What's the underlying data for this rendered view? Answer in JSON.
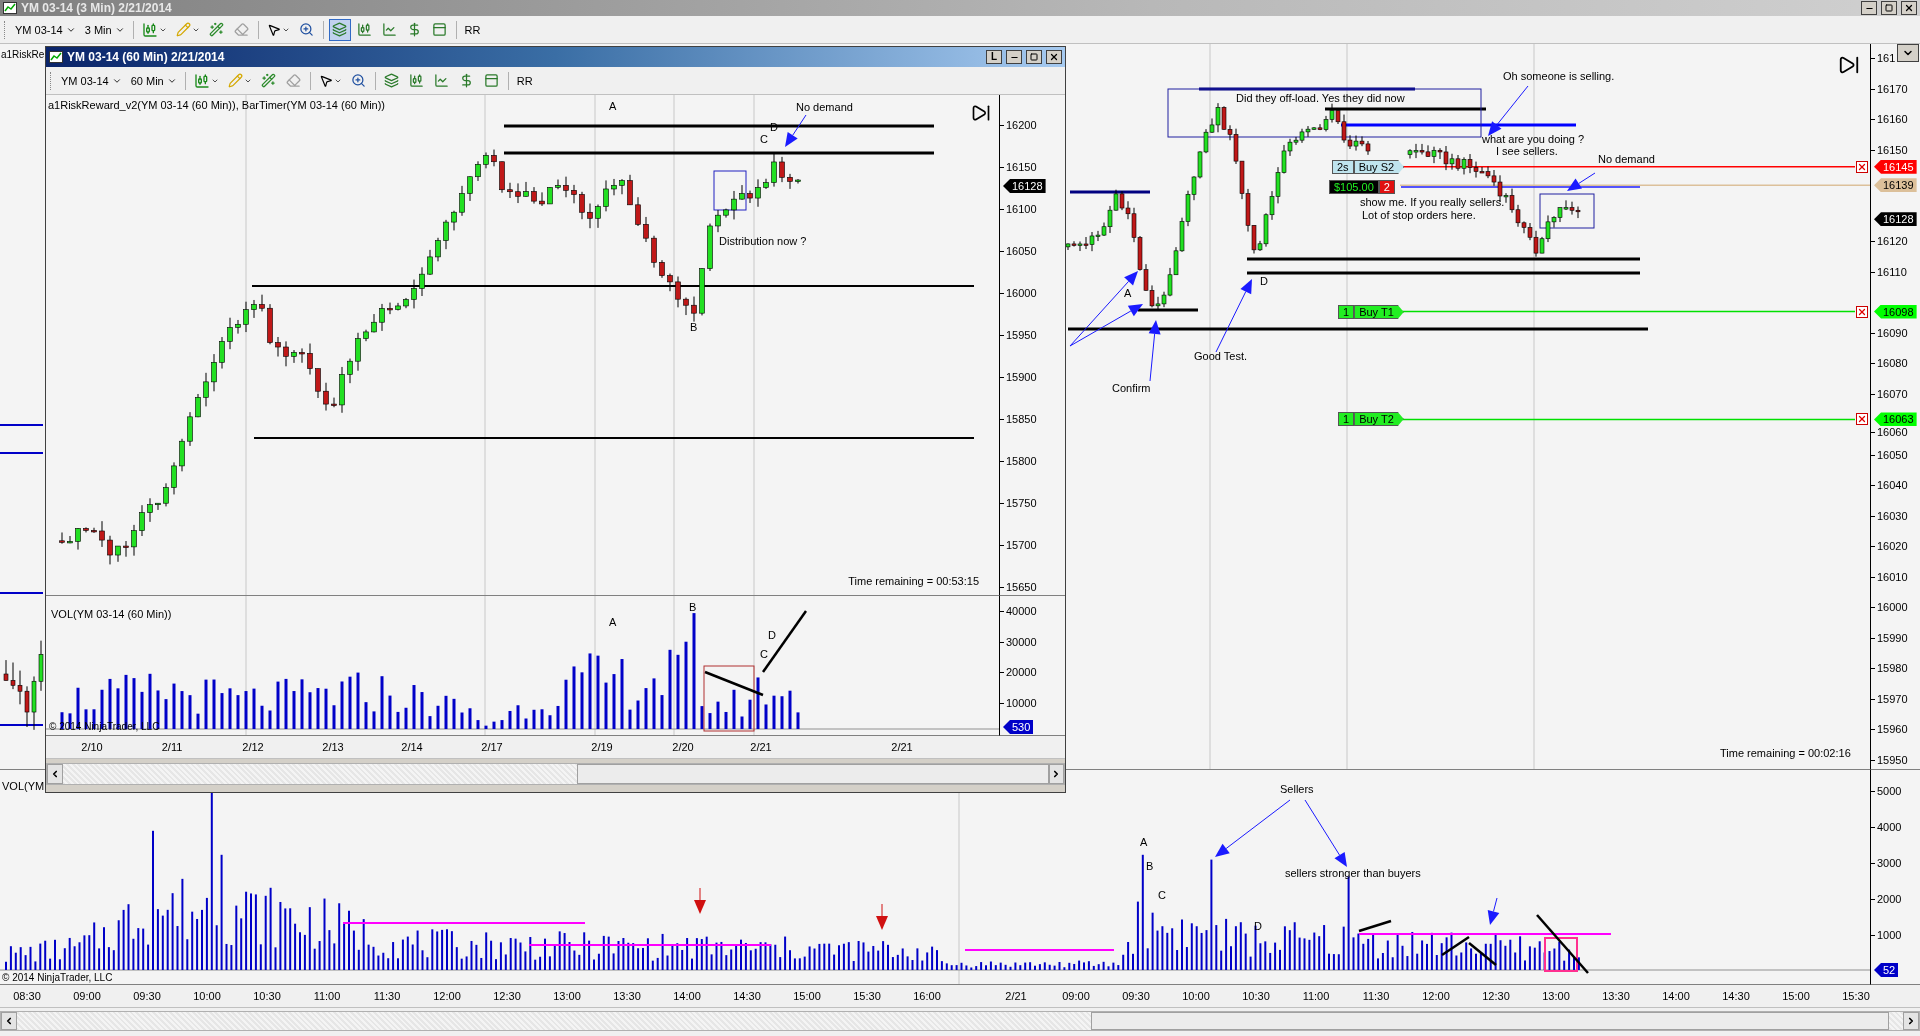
{
  "window": {
    "title": "YM 03-14 (3 Min)  2/21/2014"
  },
  "toolbar": {
    "instrument": "YM 03-14",
    "interval": "3 Min",
    "rr": "RR",
    "chart_tools": [
      {
        "kind": "strategy",
        "selected": true
      },
      {
        "kind": "bars",
        "selected": false
      },
      {
        "kind": "line",
        "selected": false
      },
      {
        "kind": "dollar",
        "selected": false
      },
      {
        "kind": "properties",
        "selected": false
      }
    ]
  },
  "chart": {
    "indicator_label": "a1RiskRe",
    "price_axis": [
      "161",
      "16170",
      "16160",
      "16150",
      "16120",
      "16110",
      "16090",
      "16080",
      "16070",
      "16060",
      "16050",
      "16040",
      "16030",
      "16020",
      "16010",
      "16000",
      "15990",
      "15980",
      "15970",
      "15960",
      "15950"
    ],
    "price_markers": [
      {
        "text": "16145",
        "color": "#ff0000"
      },
      {
        "text": "16139",
        "color": "#dcc09a"
      },
      {
        "text": "16128",
        "color": "#000000"
      },
      {
        "text": "16098",
        "color": "#00ff00"
      },
      {
        "text": "16063",
        "color": "#00ff00"
      }
    ],
    "orders": [
      {
        "kind": "stop",
        "qty": "2s",
        "label": "Buy S2"
      },
      {
        "kind": "target",
        "qty": "1",
        "label": "Buy T1"
      },
      {
        "kind": "target",
        "qty": "1",
        "label": "Buy T2"
      }
    ],
    "position": {
      "pnl": "$105.00",
      "qty": "2"
    },
    "annotations": [
      "Did they off-load. Yes they did now",
      "Oh someone is selling.",
      "what are you doing ?",
      "I see sellers.",
      "No demand",
      "show me. If you really sellers.",
      "Lot of stop orders here.",
      "Confirm",
      "Good Test.",
      "A",
      "D"
    ],
    "timer": "Time remaining = 00:02:16"
  },
  "volume": {
    "label": "VOL(YM",
    "axis": [
      "5000",
      "4000",
      "3000",
      "2000",
      "1000"
    ],
    "marker": "52",
    "annotations": [
      "Sellers",
      "sellers stronger than buyers",
      "A",
      "B",
      "C",
      "D"
    ],
    "copyright": "© 2014 NinjaTrader, LLC"
  },
  "time_axis": [
    "08:30",
    "09:00",
    "09:30",
    "10:00",
    "10:30",
    "11:00",
    "11:30",
    "12:00",
    "12:30",
    "13:00",
    "13:30",
    "14:00",
    "14:30",
    "15:00",
    "15:30",
    "16:00",
    "2/21",
    "09:00",
    "09:30",
    "10:00",
    "10:30",
    "11:00",
    "11:30",
    "12:00",
    "12:30",
    "13:00",
    "13:30",
    "14:00",
    "14:30",
    "15:00",
    "15:30"
  ],
  "inner_window": {
    "title": "YM 03-14 (60 Min)  2/21/2014",
    "layout_button": "L",
    "toolbar": {
      "instrument": "YM 03-14",
      "interval": "60 Min",
      "rr": "RR",
      "chart_tools": [
        {
          "kind": "strategy",
          "selected": false
        },
        {
          "kind": "bars",
          "selected": false
        },
        {
          "kind": "line",
          "selected": false
        },
        {
          "kind": "dollar",
          "selected": false
        },
        {
          "kind": "properties",
          "selected": false
        }
      ]
    },
    "indicator_label": "a1RiskReward_v2(YM 03-14 (60 Min)), BarTimer(YM 03-14 (60 Min))",
    "price_axis": [
      "16200",
      "16150",
      "16100",
      "16050",
      "16000",
      "15950",
      "15900",
      "15850",
      "15800",
      "15750",
      "15700",
      "15650"
    ],
    "price_marker": "16128",
    "annotations": [
      "A",
      "No demand",
      "C",
      "D",
      "Distribution now ?",
      "B"
    ],
    "timer": "Time remaining = 00:53:15",
    "volume": {
      "label": "VOL(YM 03-14 (60 Min))",
      "axis": [
        "40000",
        "30000",
        "20000",
        "10000"
      ],
      "marker": "530",
      "annotations": [
        "A",
        "B",
        "C",
        "D"
      ],
      "copyright": "© 2014 NinjaTrader, LLC"
    },
    "date_axis": [
      "2/10",
      "2/11",
      "2/12",
      "2/13",
      "2/14",
      "2/17",
      "2/19",
      "2/20",
      "2/21",
      "2/21"
    ]
  }
}
